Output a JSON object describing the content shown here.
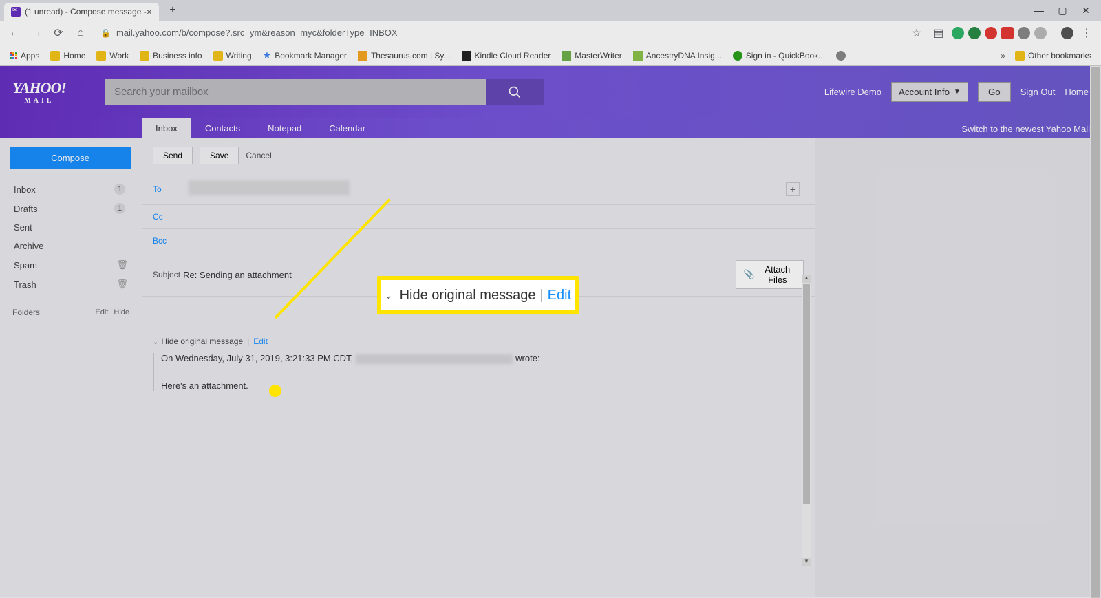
{
  "browser": {
    "tab_title": "(1 unread) - Compose message -",
    "url": "mail.yahoo.com/b/compose?.src=ym&reason=myc&folderType=INBOX"
  },
  "bookmarks": {
    "apps": "Apps",
    "items": [
      "Home",
      "Work",
      "Business info",
      "Writing",
      "Bookmark Manager",
      "Thesaurus.com | Sy...",
      "Kindle Cloud Reader",
      "MasterWriter",
      "AncestryDNA Insig...",
      "Sign in - QuickBook..."
    ],
    "other": "Other bookmarks"
  },
  "header": {
    "logo_big": "YAHOO!",
    "logo_small": "MAIL",
    "search_placeholder": "Search your mailbox",
    "user": "Lifewire Demo",
    "account_info": "Account Info",
    "go": "Go",
    "sign_out": "Sign Out",
    "home": "Home"
  },
  "tabs": {
    "items": [
      "Inbox",
      "Contacts",
      "Notepad",
      "Calendar"
    ],
    "switch": "Switch to the newest Yahoo Mail"
  },
  "sidebar": {
    "compose": "Compose",
    "folders": [
      {
        "name": "Inbox",
        "count": "1"
      },
      {
        "name": "Drafts",
        "count": "1"
      },
      {
        "name": "Sent"
      },
      {
        "name": "Archive"
      },
      {
        "name": "Spam",
        "trash": true
      },
      {
        "name": "Trash",
        "trash": true
      }
    ],
    "folders_label": "Folders",
    "edit": "Edit",
    "hide": "Hide"
  },
  "compose": {
    "send": "Send",
    "save": "Save",
    "cancel": "Cancel",
    "to_label": "To",
    "cc_label": "Cc",
    "bcc_label": "Bcc",
    "subject_label": "Subject",
    "subject_value": "Re: Sending an attachment",
    "attach": "Attach Files",
    "hide_original": "Hide original message",
    "edit": "Edit",
    "quoted_prefix": "On Wednesday, July 31, 2019, 3:21:33 PM CDT,",
    "quoted_suffix": "wrote:",
    "quoted_body": "Here's an attachment."
  },
  "callout": {
    "text": "Hide original message",
    "edit": "Edit"
  }
}
